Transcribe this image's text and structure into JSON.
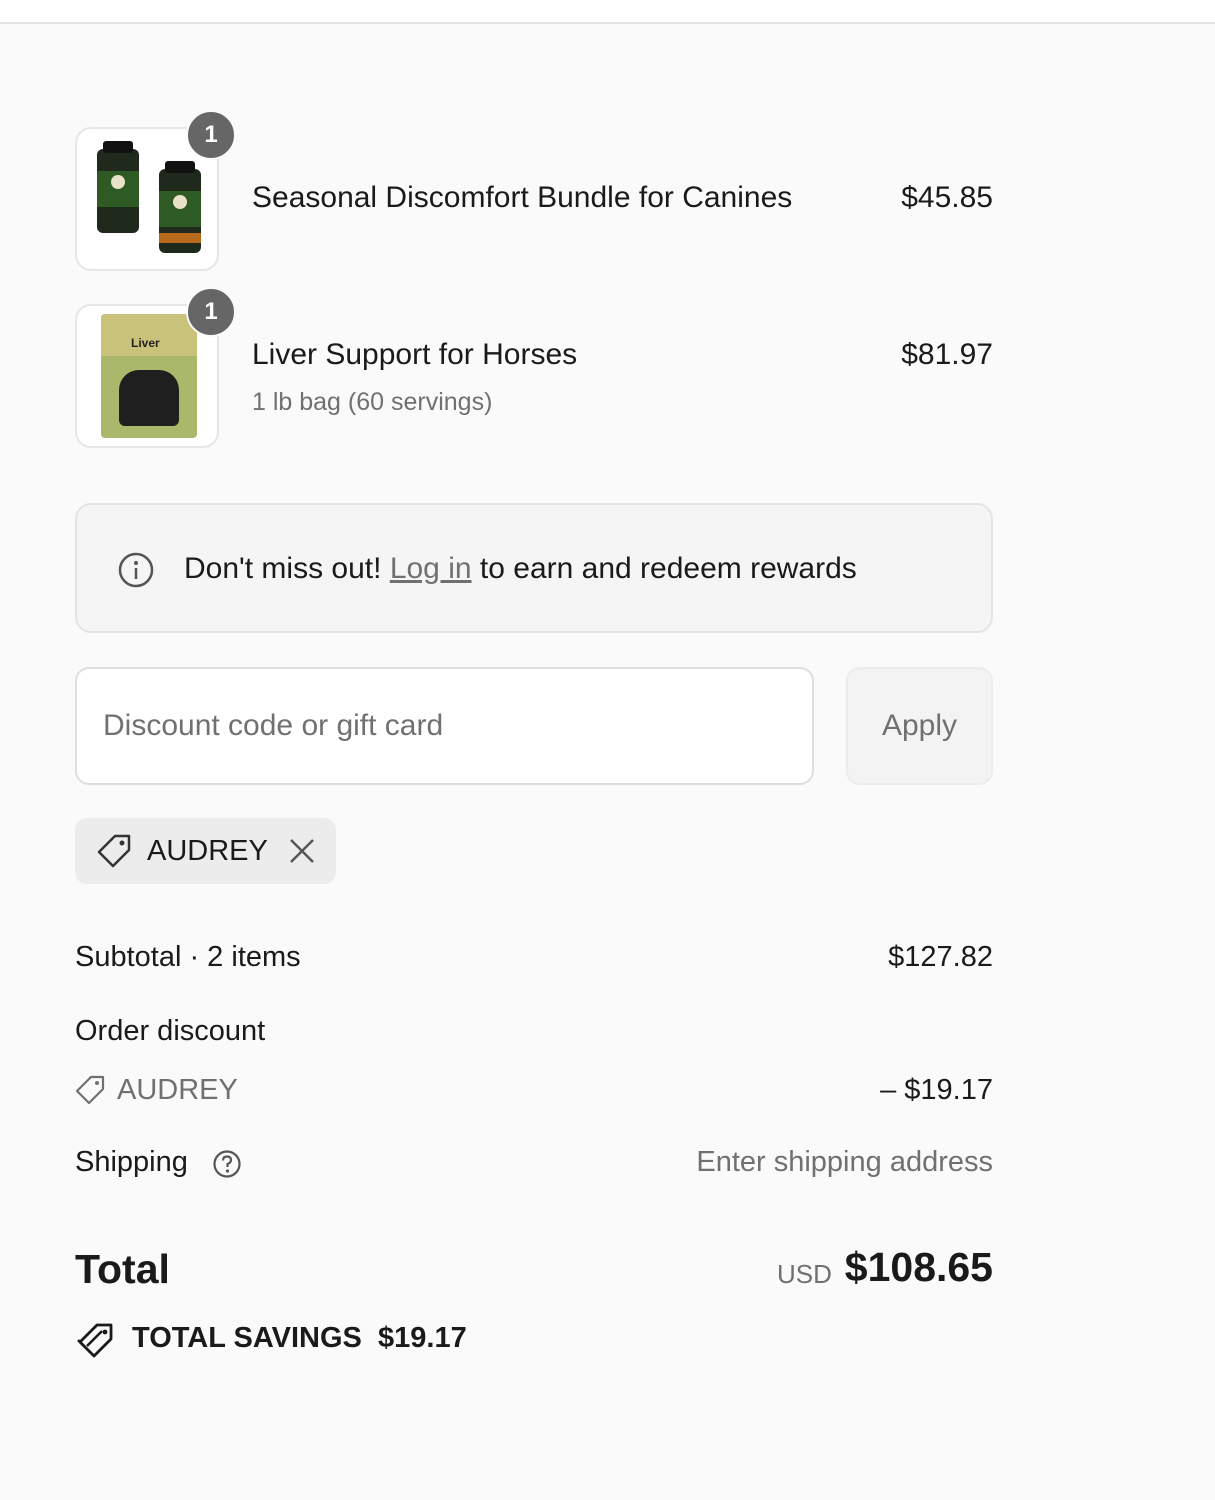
{
  "line_items": [
    {
      "name": "Seasonal Discomfort Bundle for Canines",
      "variant": "",
      "price": "$45.85",
      "quantity": "1"
    },
    {
      "name": "Liver Support for Horses",
      "variant": "1 lb bag (60 servings)",
      "price": "$81.97",
      "quantity": "1",
      "image_text": "Liver"
    }
  ],
  "rewards": {
    "prefix": "Don't miss out!",
    "link": "Log in",
    "suffix": "to earn and redeem rewards"
  },
  "discount": {
    "placeholder": "Discount code or gift card",
    "apply_label": "Apply",
    "applied_code": "AUDREY"
  },
  "summary": {
    "subtotal_label": "Subtotal · 2 items",
    "subtotal_value": "$127.82",
    "order_discount_label": "Order discount",
    "discount_code": "AUDREY",
    "discount_value": "– $19.17",
    "shipping_label": "Shipping",
    "shipping_value": "Enter shipping address",
    "total_label": "Total",
    "currency": "USD",
    "total_value": "$108.65",
    "savings_label": "TOTAL SAVINGS",
    "savings_value": "$19.17"
  },
  "icons": {
    "info": "info-icon",
    "tag": "tag-icon",
    "close": "close-icon",
    "help": "question-circle-icon",
    "savings": "double-tag-icon"
  },
  "colors": {
    "background": "#fafafa",
    "badge": "#666666",
    "muted_text": "#707070",
    "text": "#1a1a1a"
  }
}
